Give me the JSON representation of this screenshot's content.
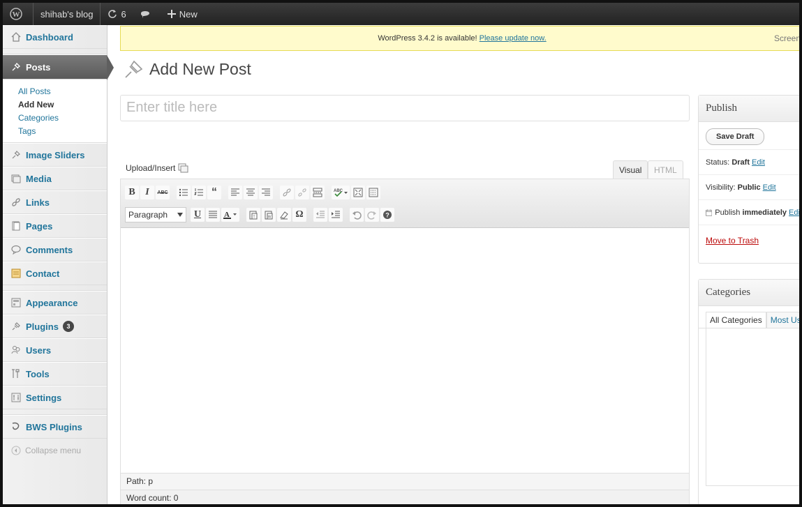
{
  "adminbar": {
    "site_name": "shihab's blog",
    "updates_count": "6",
    "new_label": "New"
  },
  "notice": {
    "text": "WordPress 3.4.2 is available!",
    "link": "Please update now.",
    "screen_options": "Screen"
  },
  "sidebar": {
    "dashboard": "Dashboard",
    "posts": "Posts",
    "submenu": [
      "All Posts",
      "Add New",
      "Categories",
      "Tags"
    ],
    "image_sliders": "Image Sliders",
    "media": "Media",
    "links": "Links",
    "pages": "Pages",
    "comments": "Comments",
    "contact": "Contact",
    "appearance": "Appearance",
    "plugins": "Plugins",
    "plugins_badge": "3",
    "users": "Users",
    "tools": "Tools",
    "settings": "Settings",
    "bws_plugins": "BWS Plugins",
    "collapse": "Collapse menu"
  },
  "page": {
    "title": "Add New Post",
    "title_placeholder": "Enter title here"
  },
  "editor": {
    "upload_label": "Upload/Insert",
    "tab_visual": "Visual",
    "tab_html": "HTML",
    "format_select": "Paragraph",
    "path": "Path: p",
    "word_count": "Word count: 0"
  },
  "publish": {
    "heading": "Publish",
    "save_draft": "Save Draft",
    "status_label": "Status:",
    "status_value": "Draft",
    "visibility_label": "Visibility:",
    "visibility_value": "Public",
    "publish_label": "Publish",
    "publish_value": "immediately",
    "edit": "Edit",
    "trash": "Move to Trash"
  },
  "categories": {
    "heading": "Categories",
    "tab_all": "All Categories",
    "tab_most": "Most Used"
  },
  "colors": {
    "link": "#21759b",
    "adminbar": "#222222",
    "notice_bg": "#fffbcc",
    "trash": "#bc0b0b"
  }
}
